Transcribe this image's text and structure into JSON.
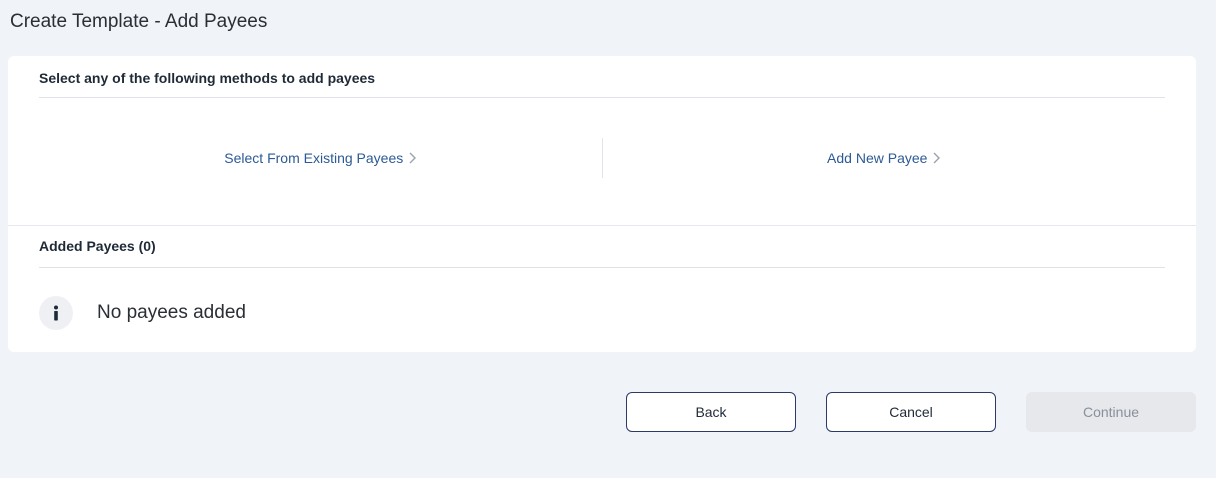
{
  "page": {
    "title": "Create Template - Add Payees"
  },
  "methods": {
    "heading": "Select any of the following methods to add payees",
    "existing_label": "Select From Existing Payees",
    "new_label": "Add New Payee"
  },
  "added": {
    "heading": "Added Payees (0)",
    "empty_text": "No payees added"
  },
  "actions": {
    "back_label": "Back",
    "cancel_label": "Cancel",
    "continue_label": "Continue"
  },
  "icons": {
    "chevron": "chevron-right-icon",
    "info": "info-icon"
  },
  "colors": {
    "link": "#2c5a95",
    "button_border": "#2b3b66",
    "disabled_bg": "#e6e8ec",
    "page_bg": "#f0f3f7"
  }
}
